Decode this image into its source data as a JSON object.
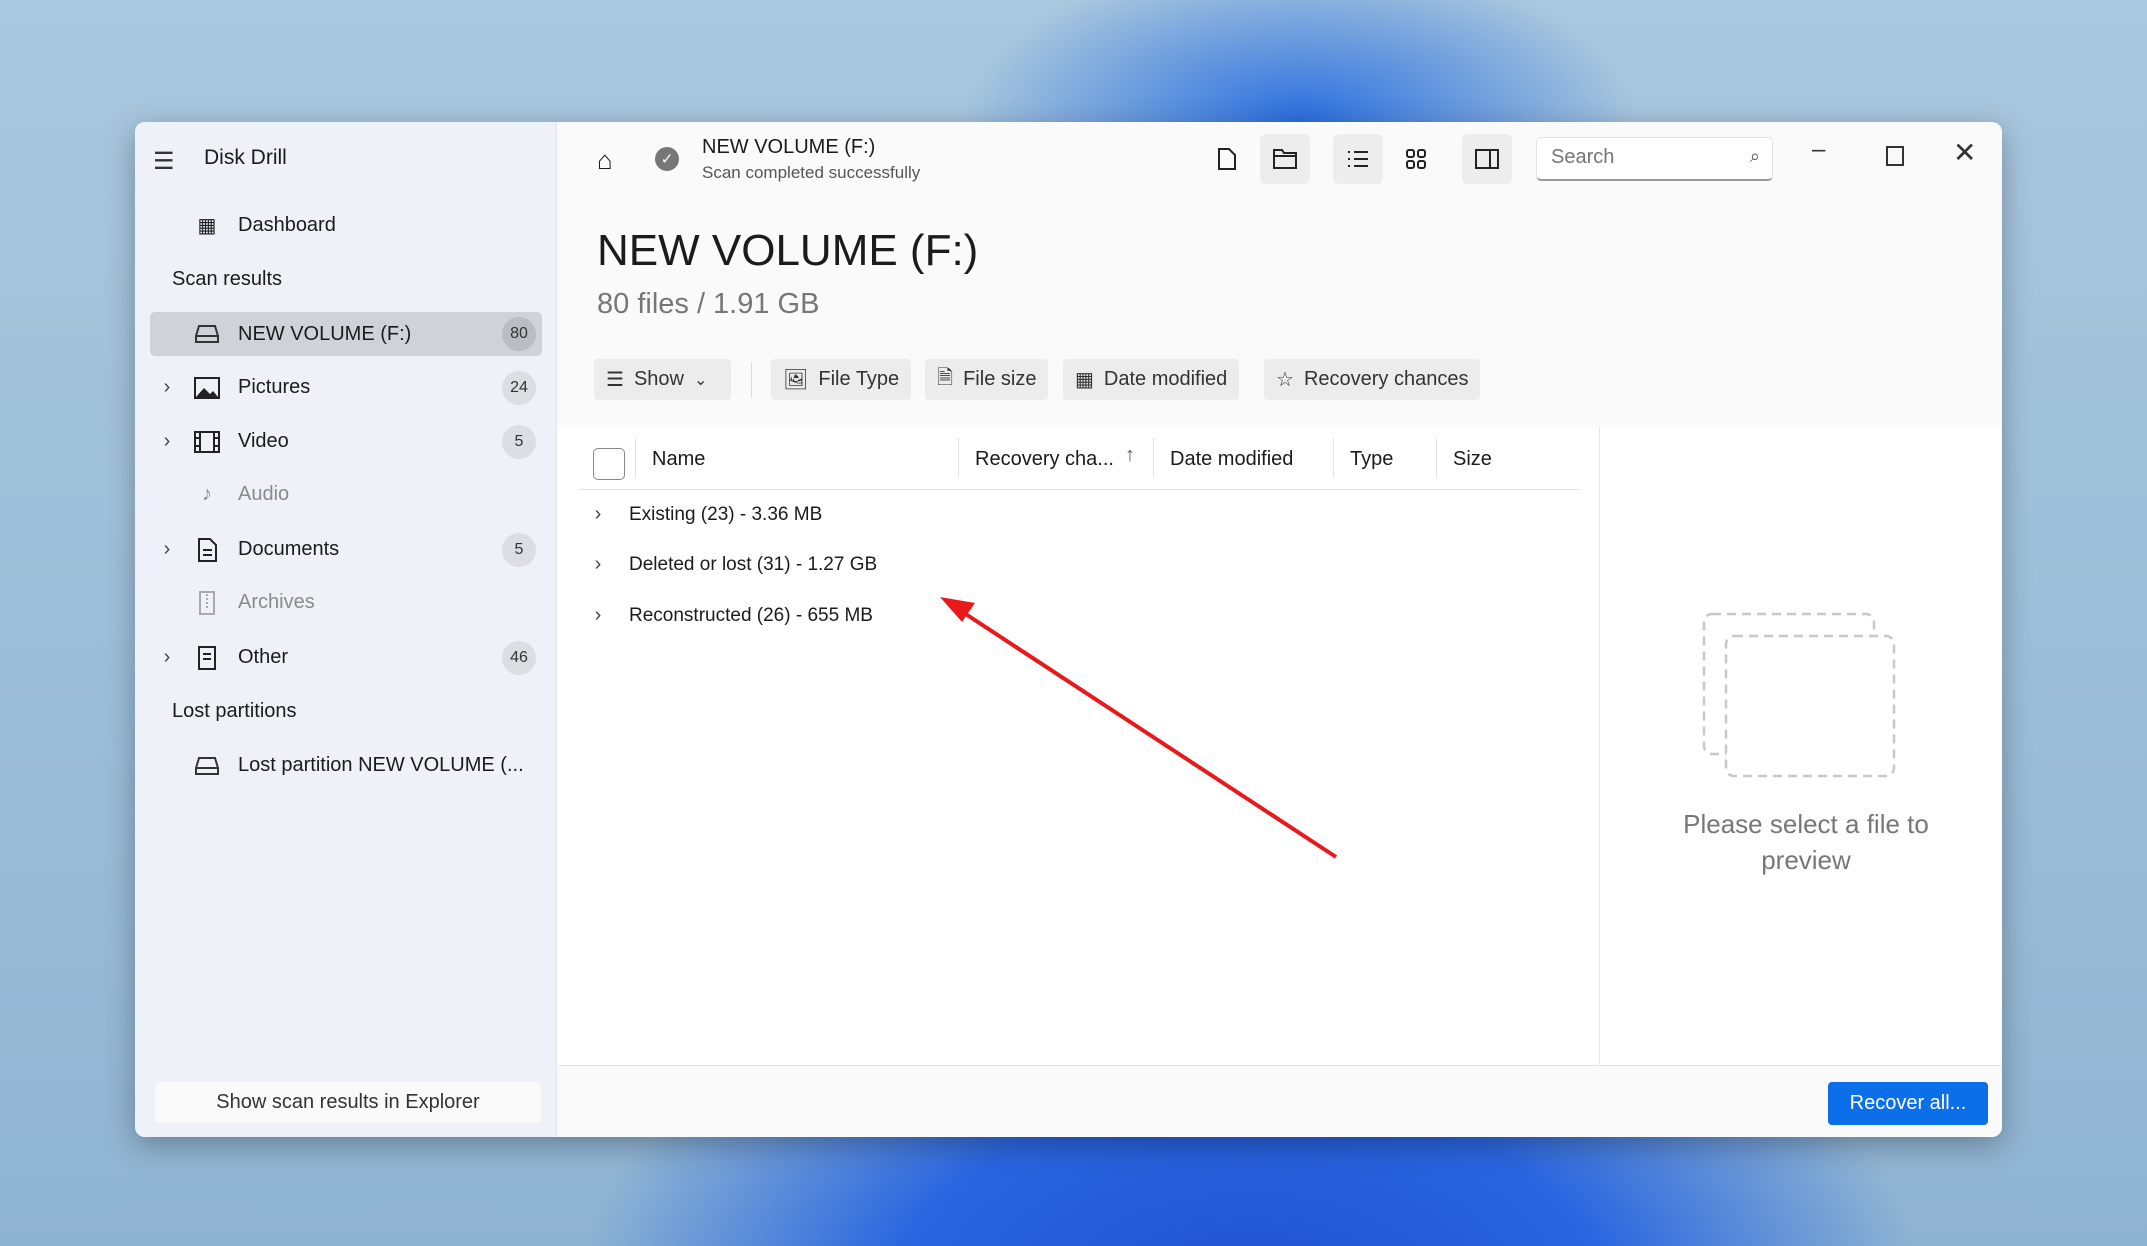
{
  "app": {
    "title": "Disk Drill"
  },
  "sidebar": {
    "dashboard": "Dashboard",
    "scan_results_heading": "Scan results",
    "items": [
      {
        "label": "NEW VOLUME (F:)",
        "count": "80"
      },
      {
        "label": "Pictures",
        "count": "24"
      },
      {
        "label": "Video",
        "count": "5"
      },
      {
        "label": "Audio"
      },
      {
        "label": "Documents",
        "count": "5"
      },
      {
        "label": "Archives"
      },
      {
        "label": "Other",
        "count": "46"
      }
    ],
    "lost_partitions_heading": "Lost partitions",
    "lost_partition": "Lost partition NEW VOLUME (...",
    "explorer_button": "Show scan results in Explorer"
  },
  "header": {
    "title": "NEW VOLUME (F:)",
    "status": "Scan completed successfully",
    "search_placeholder": "Search"
  },
  "main": {
    "title": "NEW VOLUME (F:)",
    "summary": "80 files / 1.91 GB",
    "filters": {
      "show": "Show",
      "file_type": "File Type",
      "file_size": "File size",
      "date_modified": "Date modified",
      "recovery_chances": "Recovery chances"
    },
    "columns": {
      "name": "Name",
      "recovery": "Recovery cha...",
      "date": "Date modified",
      "type": "Type",
      "size": "Size"
    },
    "rows": [
      "Existing (23) - 3.36 MB",
      "Deleted or lost (31) - 1.27 GB",
      "Reconstructed (26) - 655 MB"
    ]
  },
  "preview": {
    "text": "Please select a file to preview"
  },
  "footer": {
    "recover_all": "Recover all..."
  },
  "colors": {
    "accent": "#0a6fe8",
    "arrow": "#e8191a"
  }
}
